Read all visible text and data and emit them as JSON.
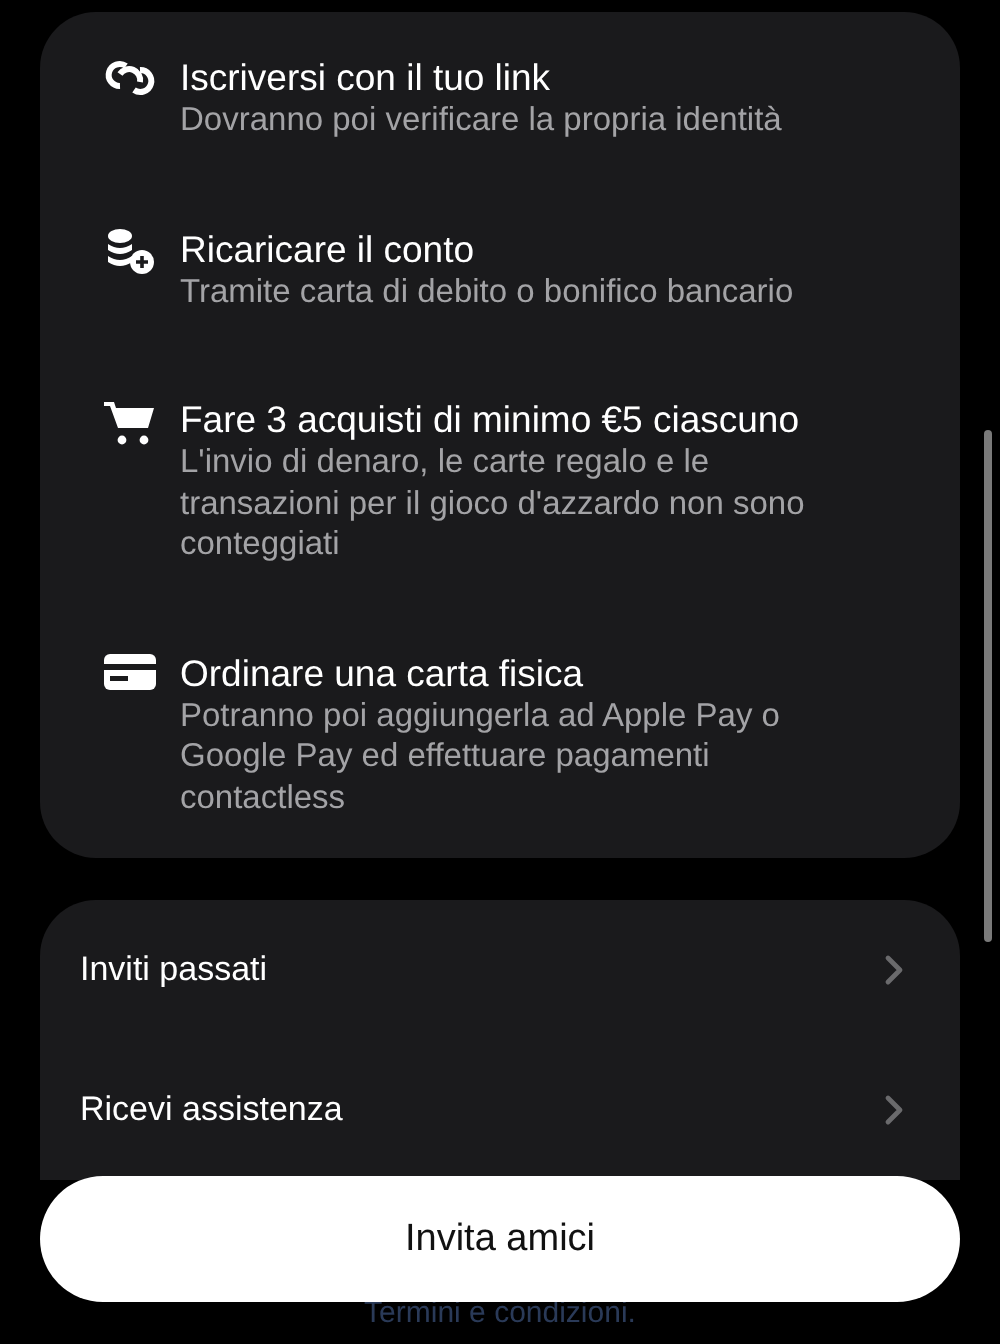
{
  "steps": [
    {
      "title": "Iscriversi con il tuo link",
      "description": "Dovranno poi verificare la propria identità"
    },
    {
      "title": "Ricaricare il conto",
      "description": "Tramite carta di debito o bonifico bancario"
    },
    {
      "title": "Fare 3 acquisti di minimo €5 ciascuno",
      "description": "L'invio di denaro, le carte regalo e le transazioni per il gioco d'azzardo non sono conteggiati"
    },
    {
      "title": "Ordinare una carta fisica",
      "description": "Potranno poi aggiungerla ad Apple Pay o Google Pay ed effettuare pagamenti contactless"
    }
  ],
  "menu": [
    {
      "label": "Inviti passati"
    },
    {
      "label": "Ricevi assistenza"
    }
  ],
  "primary_button": "Invita amici",
  "footer_link": "Termini e condizioni."
}
